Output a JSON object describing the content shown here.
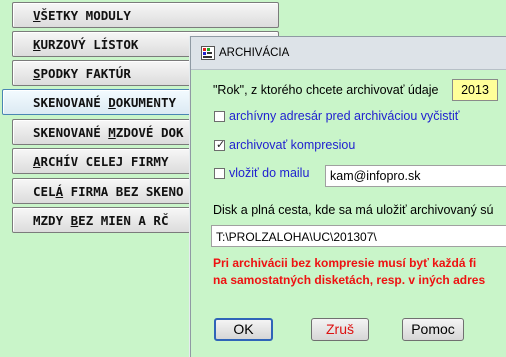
{
  "menu": {
    "items": [
      {
        "hotkey": "V",
        "rest": "ŠETKY MODULY"
      },
      {
        "hotkey": "K",
        "rest": "URZOVÝ LÍSTOK"
      },
      {
        "hotkey": "S",
        "rest": "PODKY FAKTÚR"
      },
      {
        "pre": "SKENOVANÉ ",
        "hotkey": "D",
        "rest": "OKUMENTY"
      },
      {
        "pre": "SKENOVANÉ ",
        "hotkey": "M",
        "rest": "ZDOVÉ DOK"
      },
      {
        "hotkey": "A",
        "rest": "RCHÍV CELEJ FIRMY"
      },
      {
        "pre": "CEL",
        "hotkey": "Á",
        "rest": " FIRMA BEZ SKENO"
      },
      {
        "pre": "MZDY ",
        "hotkey": "B",
        "rest": "EZ MIEN A RČ"
      }
    ]
  },
  "dialog": {
    "title": "ARCHIVÁCIA",
    "year_label": "\"Rok\", z ktorého chcete archivovať údaje",
    "year_value": "2013",
    "clear_dir_label": "archívny adresár pred archiváciou vyčistiť",
    "clear_dir_checked": false,
    "compress_label": "archivovať kompresiou",
    "compress_checked": true,
    "mail_label": "vložiť do mailu",
    "mail_checked": false,
    "email_value": "kam@infopro.sk",
    "path_label": "Disk a plná cesta, kde sa má uložiť archivovaný sú",
    "path_value": "T:\\PROLZALOHA\\UC\\201307\\",
    "warning_line1": "Pri archivácii bez kompresie musí byť každá fi",
    "warning_line2": "na samostatných disketách, resp. v iných adres",
    "ok_label": "OK",
    "cancel_label": "Zruš",
    "help_label": "Pomoc"
  },
  "colors": {
    "background": "#c9f5c9",
    "year_field": "#ffff99",
    "blue_text": "#1f1fd0",
    "warning_text": "#e11111"
  }
}
